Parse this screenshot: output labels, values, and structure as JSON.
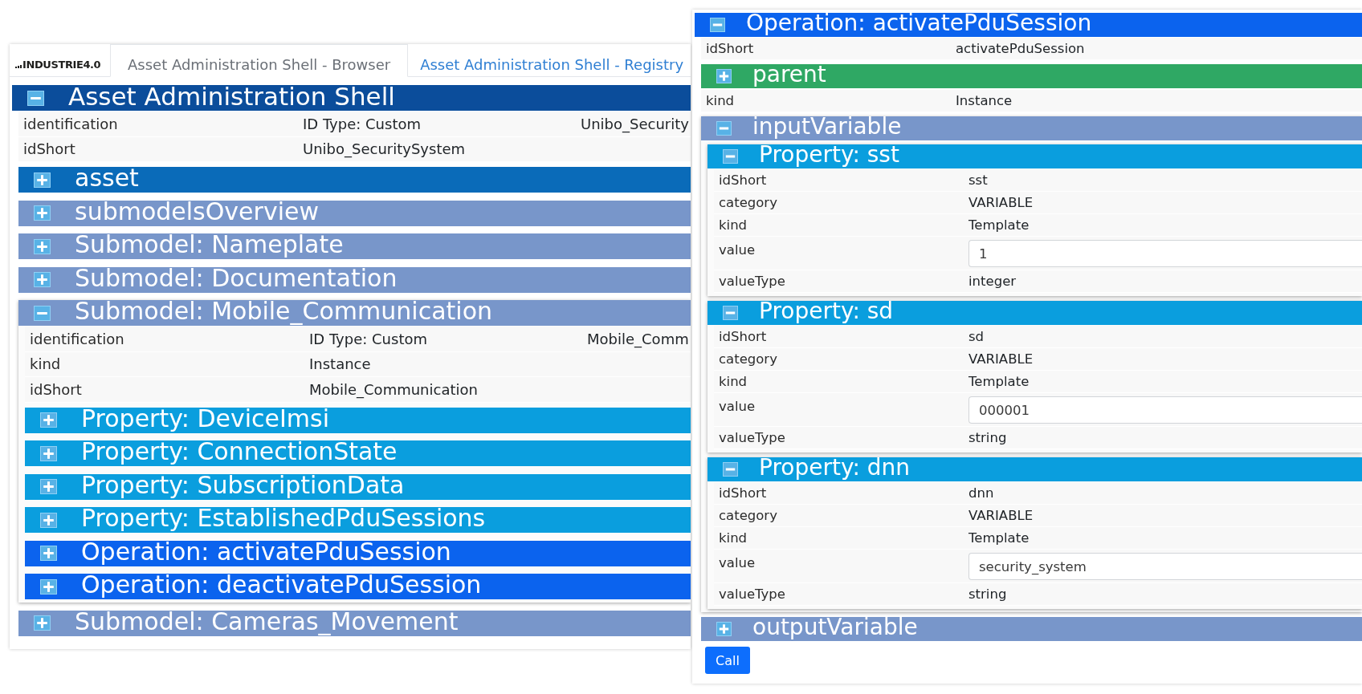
{
  "browser_view": {
    "logo": "INDUSTRIE4.0",
    "tabs": [
      {
        "label": "Asset Administration Shell - Browser",
        "selected": true
      },
      {
        "label": "Asset Administration Shell - Registry",
        "selected": false
      }
    ],
    "shell": {
      "kind": "shell",
      "title": "Asset Administration Shell",
      "expanded": true,
      "items": [
        {
          "kind": "field",
          "label": "identification",
          "value": "ID Type: Custom",
          "value_2": "Unibo_Security"
        },
        {
          "kind": "field",
          "label": "idShort",
          "value": "Unibo_SecuritySystem"
        },
        {
          "kind": "asset",
          "title": "asset",
          "expanded": false
        },
        {
          "kind": "submodel",
          "title": "submodelsOverview",
          "expanded": false
        },
        {
          "kind": "submodel",
          "title": "Submodel: Nameplate",
          "expanded": false
        },
        {
          "kind": "submodel",
          "title": "Submodel: Documentation",
          "expanded": false
        },
        {
          "kind": "submodel",
          "title": "Submodel: Mobile_Communication",
          "expanded": true,
          "items": [
            {
              "kind": "field",
              "label": "identification",
              "value": "ID Type: Custom",
              "value_2": "Mobile_Comm"
            },
            {
              "kind": "field",
              "label": "kind",
              "value": "Instance"
            },
            {
              "kind": "field",
              "label": "idShort",
              "value": "Mobile_Communication"
            },
            {
              "kind": "property",
              "title": "Property: DeviceImsi",
              "expanded": false
            },
            {
              "kind": "property",
              "title": "Property: ConnectionState",
              "expanded": false
            },
            {
              "kind": "property",
              "title": "Property: SubscriptionData",
              "expanded": false
            },
            {
              "kind": "property",
              "title": "Property: EstablishedPduSessions",
              "expanded": false
            },
            {
              "kind": "operation",
              "title": "Operation: activatePduSession",
              "expanded": false
            },
            {
              "kind": "operation",
              "title": "Operation: deactivatePduSession",
              "expanded": false
            }
          ]
        },
        {
          "kind": "submodel",
          "title": "Submodel: Cameras_Movement",
          "expanded": false
        }
      ]
    }
  },
  "operation_view": {
    "kind": "operation",
    "title": "Operation: activatePduSession",
    "expanded": true,
    "items": [
      {
        "kind": "field",
        "label": "idShort",
        "value": "activatePduSession"
      },
      {
        "kind": "reference",
        "title": "parent",
        "expanded": false
      },
      {
        "kind": "field",
        "label": "kind",
        "value": "Instance"
      },
      {
        "kind": "variable",
        "title": "inputVariable",
        "expanded": true,
        "items": [
          {
            "kind": "property",
            "title": "Property: sst",
            "expanded": true,
            "items": [
              {
                "kind": "field",
                "label": "idShort",
                "value": "sst"
              },
              {
                "kind": "field",
                "label": "category",
                "value": "VARIABLE"
              },
              {
                "kind": "field",
                "label": "kind",
                "value": "Template"
              },
              {
                "kind": "input",
                "label": "value",
                "value": "1"
              },
              {
                "kind": "field",
                "label": "valueType",
                "value": "integer"
              }
            ]
          },
          {
            "kind": "property",
            "title": "Property: sd",
            "expanded": true,
            "items": [
              {
                "kind": "field",
                "label": "idShort",
                "value": "sd"
              },
              {
                "kind": "field",
                "label": "category",
                "value": "VARIABLE"
              },
              {
                "kind": "field",
                "label": "kind",
                "value": "Template"
              },
              {
                "kind": "input",
                "label": "value",
                "value": "000001"
              },
              {
                "kind": "field",
                "label": "valueType",
                "value": "string"
              }
            ]
          },
          {
            "kind": "property",
            "title": "Property: dnn",
            "expanded": true,
            "items": [
              {
                "kind": "field",
                "label": "idShort",
                "value": "dnn"
              },
              {
                "kind": "field",
                "label": "category",
                "value": "VARIABLE"
              },
              {
                "kind": "field",
                "label": "kind",
                "value": "Template"
              },
              {
                "kind": "input",
                "label": "value",
                "value": "security_system"
              },
              {
                "kind": "field",
                "label": "valueType",
                "value": "string"
              }
            ]
          }
        ]
      },
      {
        "kind": "variable",
        "title": "outputVariable",
        "expanded": false
      },
      {
        "kind": "button",
        "label": "Call"
      }
    ]
  }
}
